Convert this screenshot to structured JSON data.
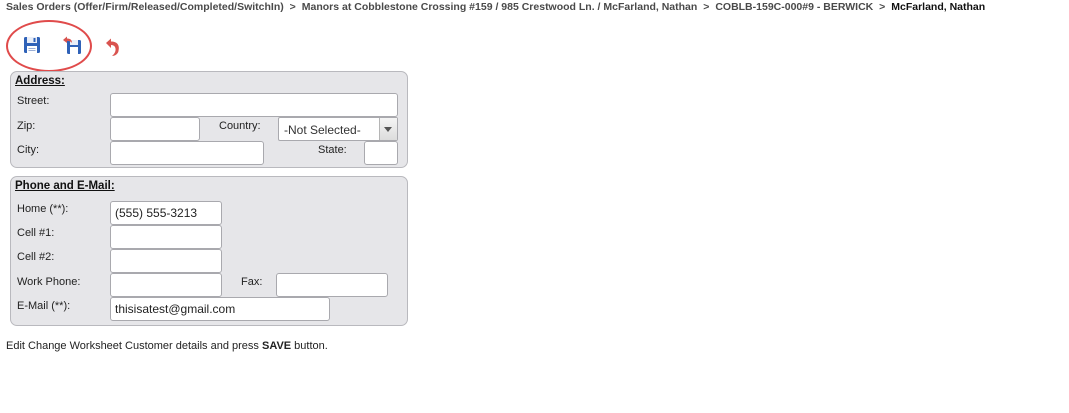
{
  "breadcrumb": {
    "items": [
      "Sales Orders (Offer/Firm/Released/Completed/SwitchIn)",
      "Manors at Cobblestone Crossing #159 / 985 Crestwood Ln. / McFarland, Nathan",
      "COBLB-159C-000#9 - BERWICK"
    ],
    "current": "McFarland, Nathan",
    "separator": ">"
  },
  "toolbar": {
    "save_icon": "floppy-disk-icon",
    "save_close_icon": "save-and-undo-icon",
    "undo_icon": "undo-arrow-icon",
    "highlight_color": "#e04b4b"
  },
  "address": {
    "title": "Address:",
    "street_label": "Street:",
    "street_value": "",
    "zip_label": "Zip:",
    "zip_value": "",
    "country_label": "Country:",
    "country_value": "-Not Selected-",
    "city_label": "City:",
    "city_value": "",
    "state_label": "State:",
    "state_value": ""
  },
  "contact": {
    "title": "Phone and E-Mail:",
    "home_label": "Home  (**):",
    "home_value": "(555) 555-3213",
    "cell1_label": "Cell #1:",
    "cell1_value": "",
    "cell2_label": "Cell #2:",
    "cell2_value": "",
    "work_label": "Work Phone:",
    "work_value": "",
    "fax_label": "Fax:",
    "fax_value": "",
    "email_label": "E-Mail (**):",
    "email_value": "thisisatest@gmail.com"
  },
  "footer": {
    "text_before": "Edit Change Worksheet Customer details and press ",
    "bold": "SAVE",
    "text_after": " button."
  }
}
